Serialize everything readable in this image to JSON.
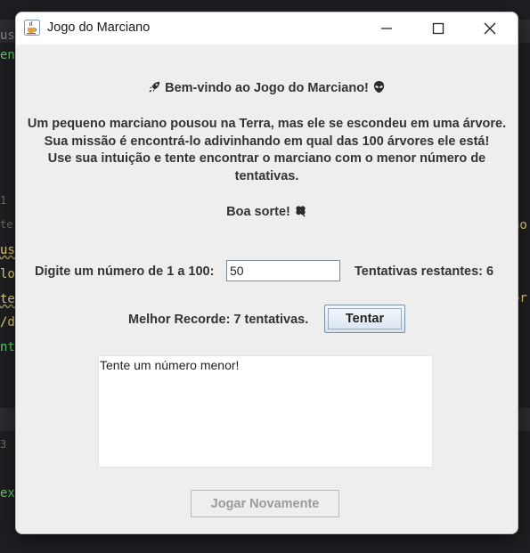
{
  "background_editor": {
    "left_fragments": [
      "us.",
      "ene",
      "te",
      "usc",
      "lo",
      "te",
      "/d",
      "nt",
      "ext"
    ],
    "left_numbers": [
      "1",
      "3"
    ],
    "right_fragments": [
      "ao",
      "or"
    ]
  },
  "window": {
    "title": "Jogo do Marciano",
    "icons": {
      "app": "java-cup-icon",
      "minimize": "minimize-icon",
      "maximize": "maximize-icon",
      "close": "close-icon"
    }
  },
  "welcome": {
    "heading": "Bem-vindo ao Jogo do Marciano!",
    "heading_left_icon": "rocket-icon",
    "heading_right_icon": "alien-icon",
    "line1": "Um pequeno marciano pousou na Terra, mas ele se escondeu em uma árvore.",
    "line2": "Sua missão é encontrá-lo adivinhando em qual das 100 árvores ele está!",
    "line3": "Use sua intuição e tente encontrar o marciano com o menor número de",
    "line4": "tentativas.",
    "good_luck": "Boa sorte!",
    "good_luck_icon": "four-leaf-clover-icon"
  },
  "guess": {
    "label": "Digite um número de 1 a 100:",
    "value": "50",
    "remaining_label": "Tentativas restantes: 6"
  },
  "record": {
    "label": "Melhor Recorde: 7 tentativas."
  },
  "buttons": {
    "try_label": "Tentar",
    "play_again_label": "Jogar Novamente"
  },
  "output": {
    "text": "Tente um número menor!"
  },
  "colors": {
    "window_bg": "#eeeeee",
    "titlebar_bg": "#ffffff",
    "text": "#333333",
    "disabled_text": "#9a9a9a",
    "ide_bg": "#1f1f23"
  }
}
